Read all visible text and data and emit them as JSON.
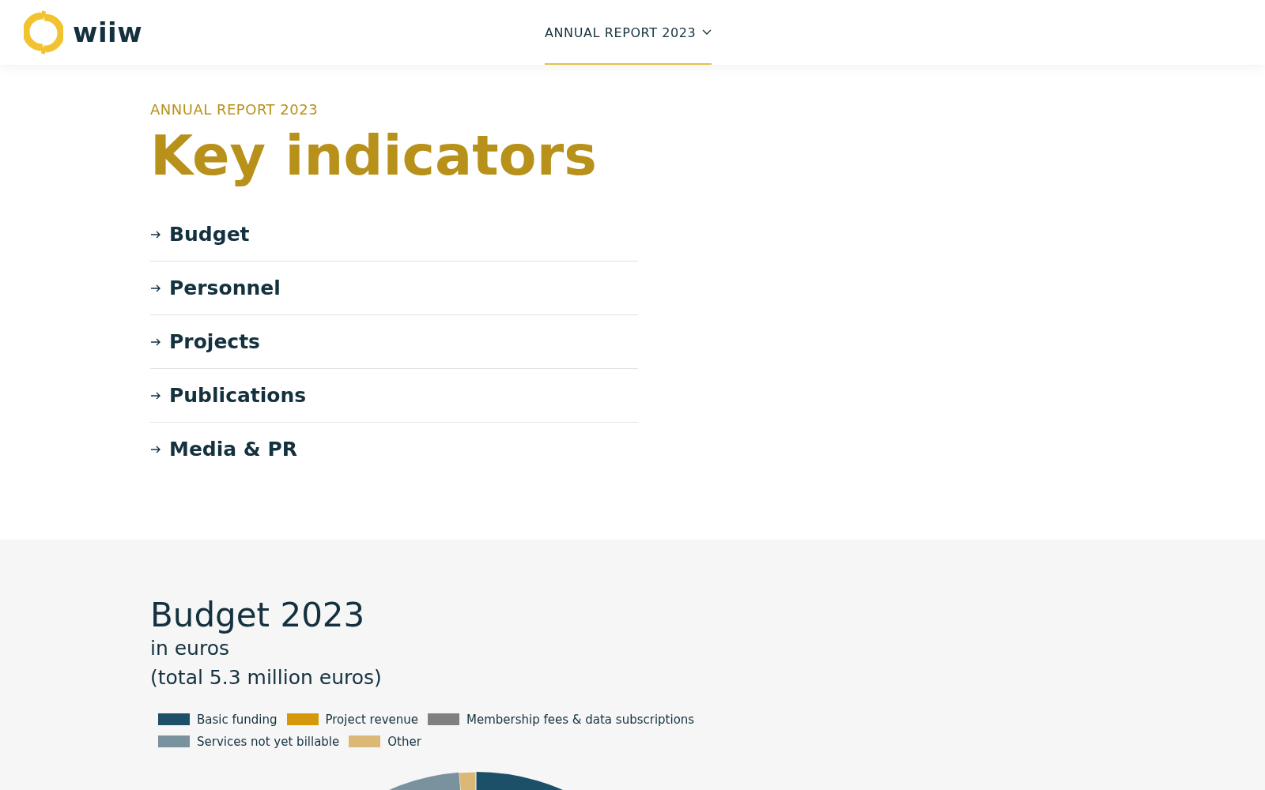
{
  "header": {
    "logo_text": "wiiw",
    "nav": [
      {
        "label": "ANNUAL REPORT 2023",
        "selected": true
      }
    ]
  },
  "intro": {
    "eyebrow": "ANNUAL REPORT 2023",
    "title": "Key indicators",
    "links": [
      {
        "label": "Budget"
      },
      {
        "label": "Personnel"
      },
      {
        "label": "Projects"
      },
      {
        "label": "Publications"
      },
      {
        "label": "Media & PR"
      }
    ]
  },
  "budget": {
    "title": "Budget 2023",
    "subtitle": "in euros",
    "note": "(total 5.3 million euros)",
    "legend": [
      {
        "label": "Basic funding",
        "color": "#1b5068"
      },
      {
        "label": "Project revenue",
        "color": "#d4980a"
      },
      {
        "label": "Membership fees & data subscriptions",
        "color": "#808080"
      },
      {
        "label": "Services not yet billable",
        "color": "#7a919e"
      },
      {
        "label": "Other",
        "color": "#dcb877"
      }
    ]
  }
}
